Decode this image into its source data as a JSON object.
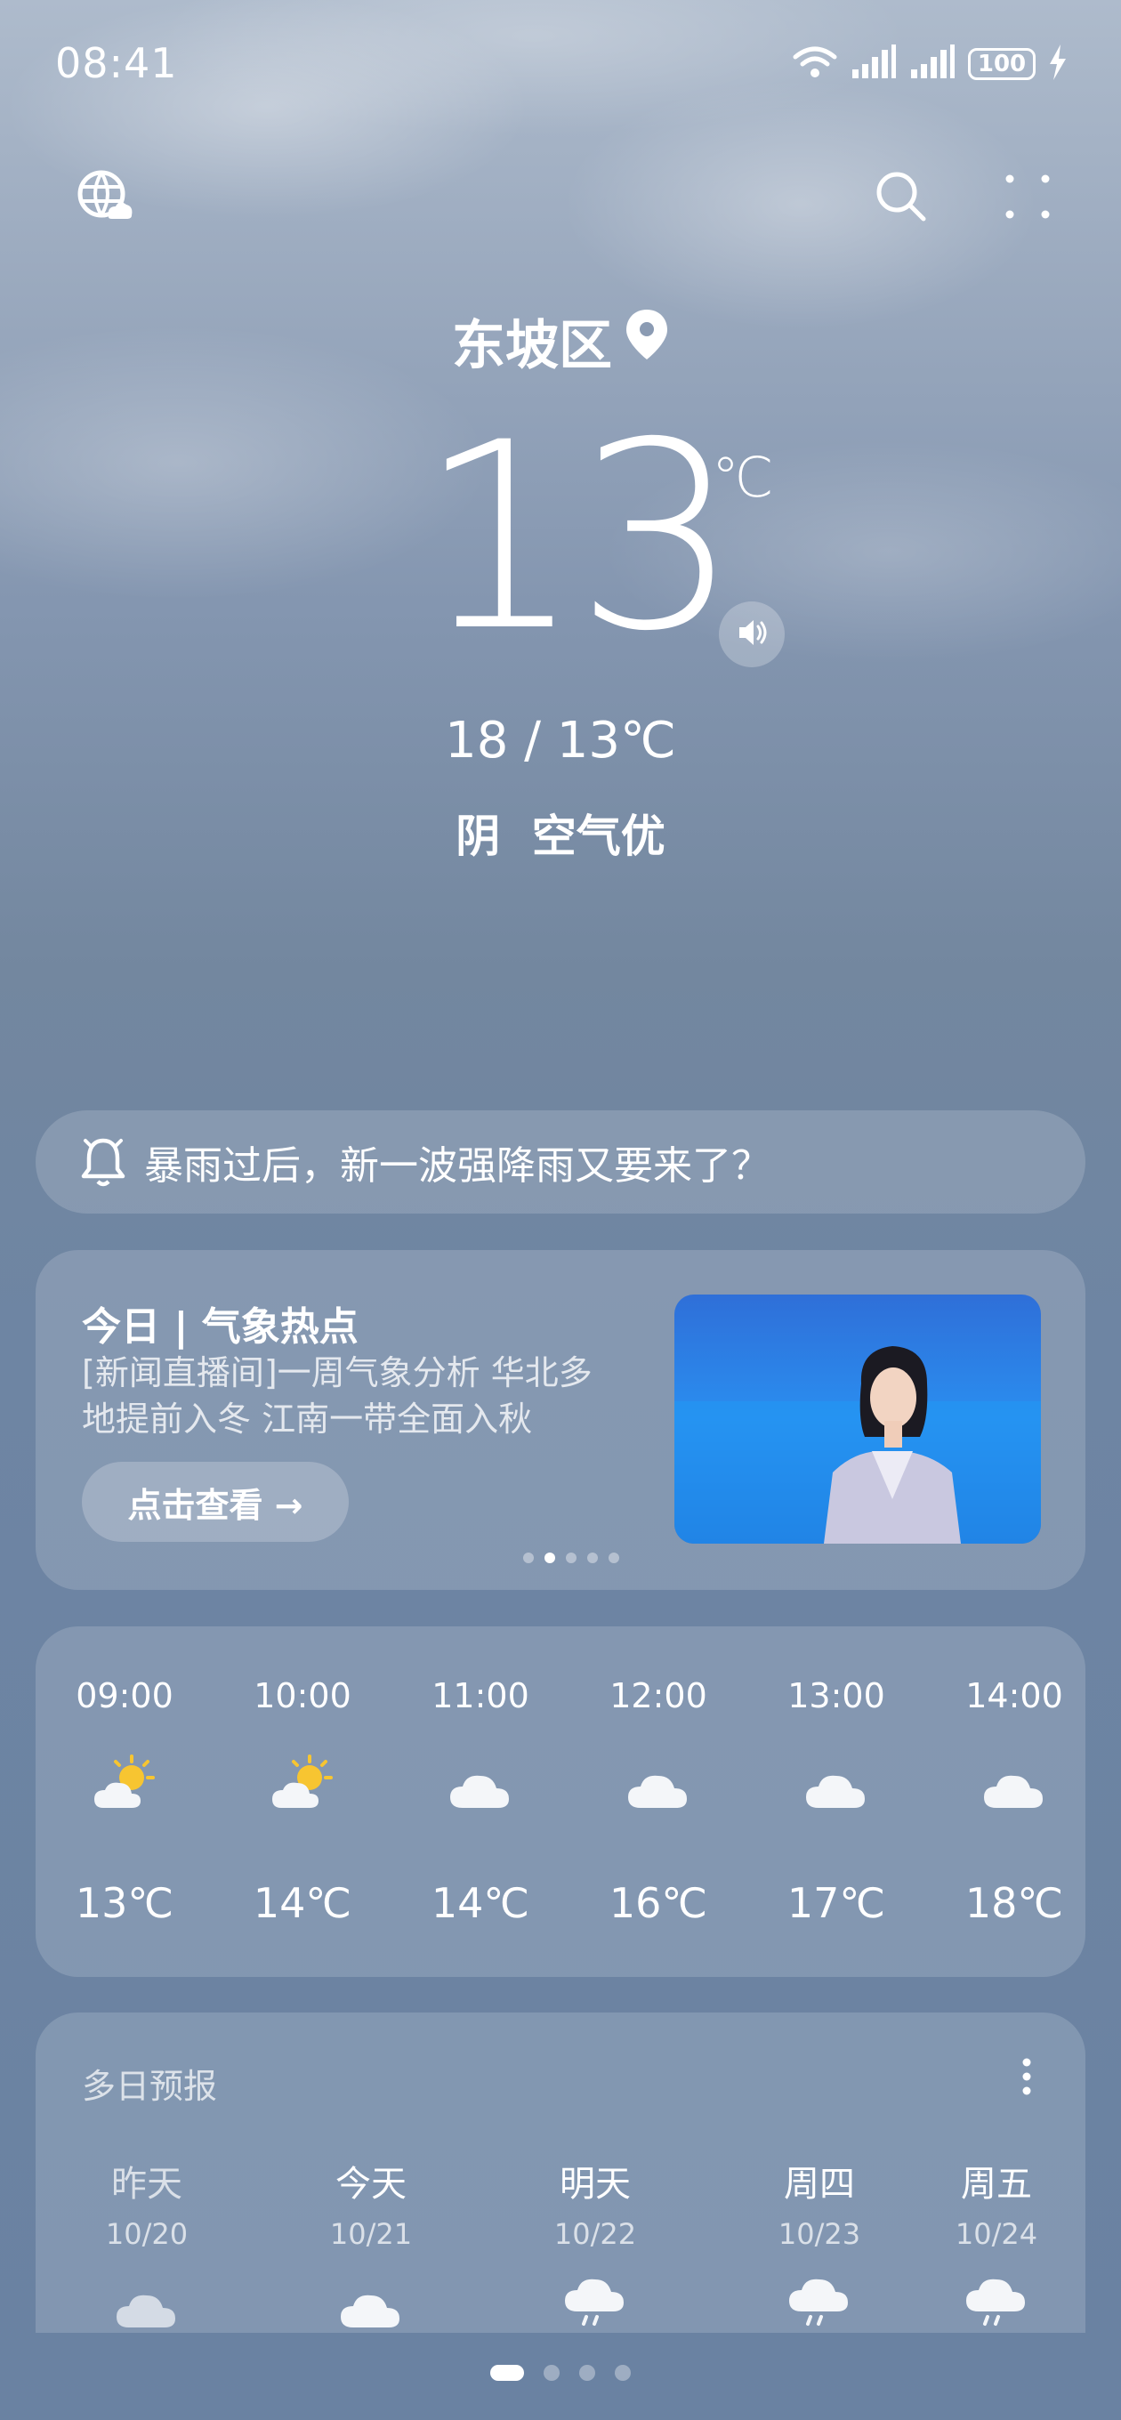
{
  "status_bar": {
    "time": "08:41",
    "battery": "100"
  },
  "location": {
    "name": "东坡区"
  },
  "current": {
    "temp": "13",
    "unit": "℃",
    "range": "18 / 13℃",
    "condition": "阴  空气优"
  },
  "alert": {
    "text": "暴雨过后，新一波强降雨又要来了？"
  },
  "news": {
    "title": "今日 | 气象热点",
    "description": "[新闻直播间]一周气象分析 华北多地提前入冬 江南一带全面入秋",
    "button": "点击查看 →",
    "carousel_dots": 5,
    "active_dot": 1
  },
  "hourly": [
    {
      "time": "09:00",
      "icon": "partly-sunny-icon",
      "temp": "13℃"
    },
    {
      "time": "10:00",
      "icon": "partly-sunny-icon",
      "temp": "14℃"
    },
    {
      "time": "11:00",
      "icon": "cloud-icon",
      "temp": "14℃"
    },
    {
      "time": "12:00",
      "icon": "cloud-icon",
      "temp": "16℃"
    },
    {
      "time": "13:00",
      "icon": "cloud-icon",
      "temp": "17℃"
    },
    {
      "time": "14:00",
      "icon": "cloud-icon",
      "temp": "18℃"
    }
  ],
  "daily": {
    "title": "多日预报",
    "days": [
      {
        "name": "昨天",
        "date": "10/20",
        "icon": "cloud-icon"
      },
      {
        "name": "今天",
        "date": "10/21",
        "icon": "cloud-icon"
      },
      {
        "name": "明天",
        "date": "10/22",
        "icon": "rain-icon"
      },
      {
        "name": "周四",
        "date": "10/23",
        "icon": "rain-icon"
      },
      {
        "name": "周五",
        "date": "10/24",
        "icon": "rain-icon"
      }
    ]
  },
  "pager": {
    "count": 4,
    "active": 0
  }
}
